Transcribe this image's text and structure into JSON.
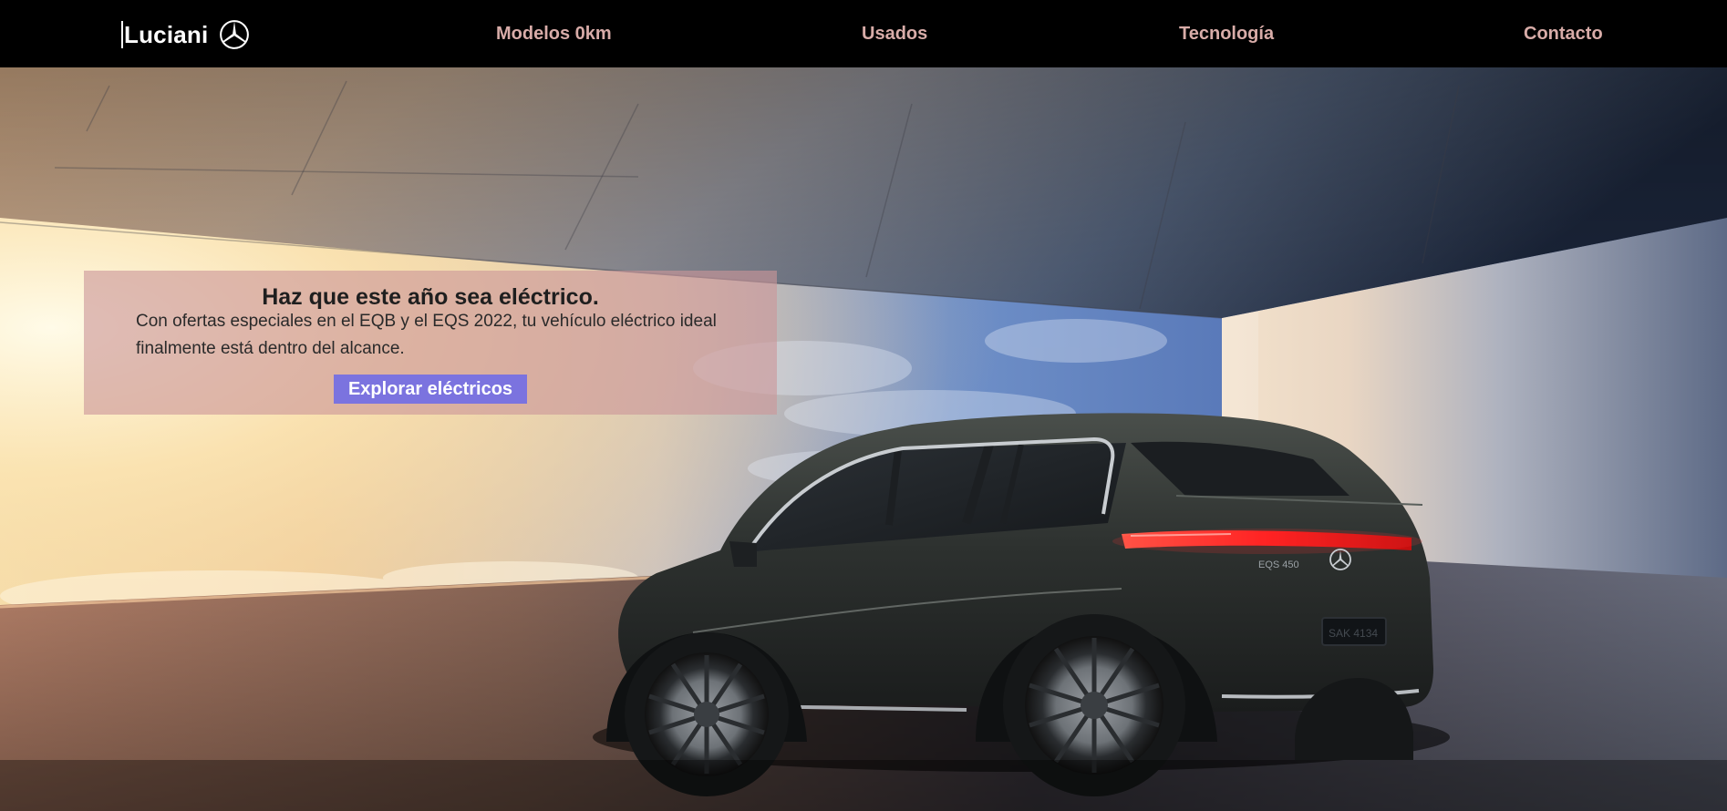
{
  "header": {
    "brand_name": "Luciani",
    "logo_icon": "mercedes-star-icon",
    "nav": [
      {
        "label": "Modelos 0km"
      },
      {
        "label": "Usados"
      },
      {
        "label": "Tecnología"
      },
      {
        "label": "Contacto"
      }
    ]
  },
  "promo": {
    "title": "Haz que este año sea eléctrico.",
    "text": "Con ofertas especiales en el EQB y el EQS 2022, tu vehículo eléctrico ideal finalmente está dentro del alcance.",
    "cta_label": "Explorar eléctricos"
  },
  "hero": {
    "image": "electric-suv-rear-view-in-concrete-pavilion-at-sunset",
    "badge_text": "EQS 450",
    "plate_text": "SAK 4134"
  },
  "colors": {
    "header_bg": "#000000",
    "brand_text": "#ffffff",
    "nav_text": "#d8aca8",
    "promo_bg": "#cc969a",
    "cta_bg": "#7b73df",
    "cta_text": "#ffffff",
    "tail_light": "#ff2a2a",
    "car_body": "#2e3230"
  }
}
